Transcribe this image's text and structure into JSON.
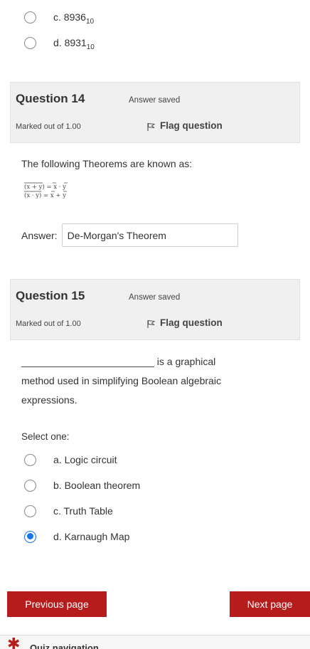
{
  "prev_question": {
    "options": [
      {
        "letter": "c.",
        "value": "8936",
        "subscript": "10",
        "checked": false
      },
      {
        "letter": "d.",
        "value": "8931",
        "subscript": "10",
        "checked": false
      }
    ]
  },
  "question14": {
    "number_label": "Question 14",
    "state": "Answer saved",
    "marks": "Marked out of 1.00",
    "flag_label": "Flag question",
    "text": "The following Theorems are known as:",
    "answer_label": "Answer:",
    "answer_value": "De-Morgan's Theorem"
  },
  "question15": {
    "number_label": "Question 15",
    "state": "Answer saved",
    "marks": "Marked out of 1.00",
    "flag_label": "Flag question",
    "text_line1_blank": "________________________",
    "text_line1": "is a graphical",
    "text_line2": "method used in simplifying Boolean algebraic",
    "text_line3": "expressions.",
    "select_label": "Select one:",
    "options": [
      {
        "label": "a. Logic circuit",
        "checked": false
      },
      {
        "label": "b. Boolean theorem",
        "checked": false
      },
      {
        "label": "c. Truth Table",
        "checked": false
      },
      {
        "label": "d. Karnaugh Map",
        "checked": true
      }
    ]
  },
  "navigation": {
    "previous_label": "Previous page",
    "next_label": "Next page",
    "quiz_nav_label": "Quiz navigation"
  },
  "colors": {
    "accent": "#b71c1c",
    "radio_selected": "#1a73e8",
    "panel_bg": "#f0f0f0"
  }
}
